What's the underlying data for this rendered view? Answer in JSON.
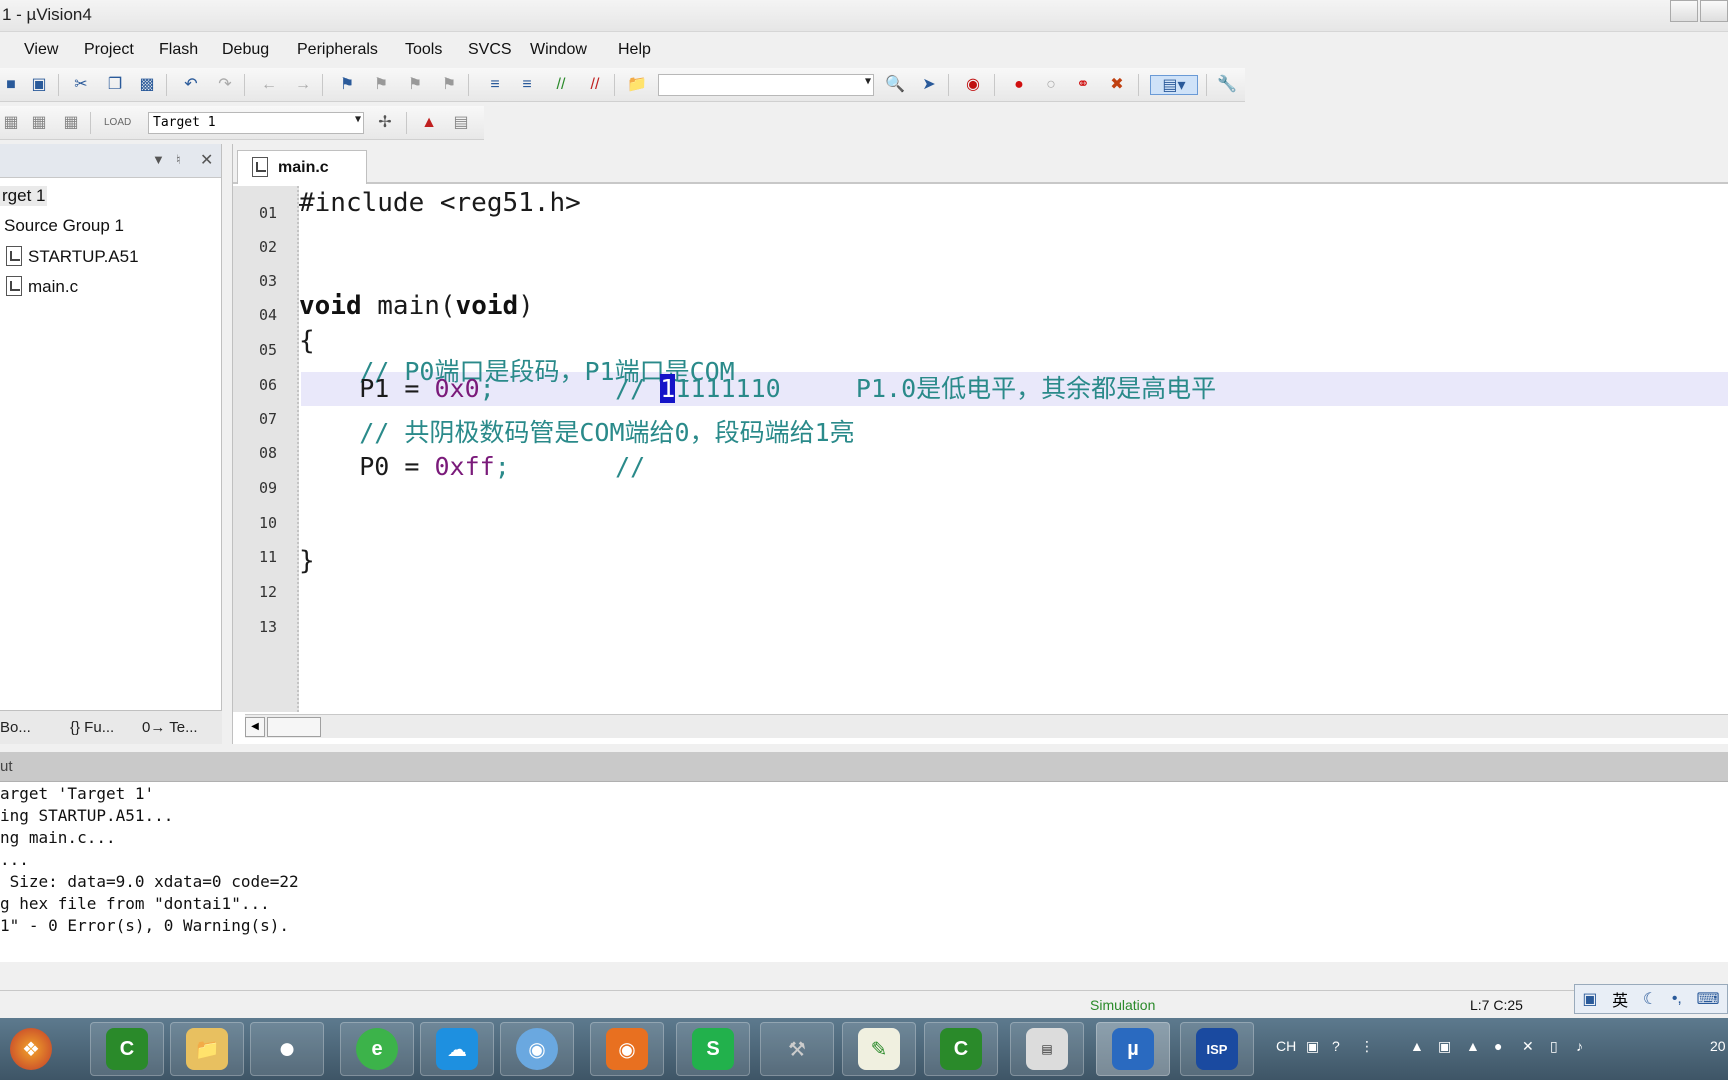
{
  "window": {
    "title": "1  - µVision4"
  },
  "menu": [
    "View",
    "Project",
    "Flash",
    "Debug",
    "Peripherals",
    "Tools",
    "SVCS",
    "Window",
    "Help"
  ],
  "toolbar": {
    "target_select": "Target 1"
  },
  "project_panel": {
    "target": "rget 1",
    "group": "Source Group 1",
    "files": [
      "STARTUP.A51",
      "main.c"
    ],
    "tabs": [
      "Bo...",
      "{} Fu...",
      "0→ Te..."
    ]
  },
  "editor": {
    "tab": "main.c",
    "line_numbers": [
      "01",
      "02",
      "03",
      "04",
      "05",
      "06",
      "07",
      "08",
      "09",
      "10",
      "11",
      "12",
      "13"
    ],
    "code": {
      "l01": "#include <reg51.h>",
      "l04_kw": "void",
      "l04_mid": " main(",
      "l04_kw2": "void",
      "l04_end": ")",
      "l05": "{",
      "l06": "    // P0端口是段码，P1端口是COM",
      "l07_pre": "    P1 = ",
      "l07_num": "0x0",
      "l07_mid": ";        // ",
      "l07_sel": "1",
      "l07_rest": "1111110     P1.0是低电平，其余都是高电平",
      "l09": "    // 共阴极数码管是COM端给0，段码端给1亮",
      "l10_pre": "    P0 = ",
      "l10_num": "0xff",
      "l10_rest": ";       //",
      "l13": "}"
    }
  },
  "output": {
    "header": "ut",
    "lines": [
      "arget 'Target 1'",
      "ing STARTUP.A51...",
      "ng main.c...",
      "...",
      " Size: data=9.0 xdata=0 code=22",
      "g hex file from \"dontai1\"...",
      "1\" - 0 Error(s), 0 Warning(s)."
    ]
  },
  "status": {
    "mode": "Simulation",
    "cursor": "L:7 C:25"
  },
  "ime": {
    "lang": "英"
  },
  "taskbar": {
    "items": [
      "C",
      "S",
      "ISP"
    ],
    "tray_text": "CH",
    "clock": "20"
  }
}
